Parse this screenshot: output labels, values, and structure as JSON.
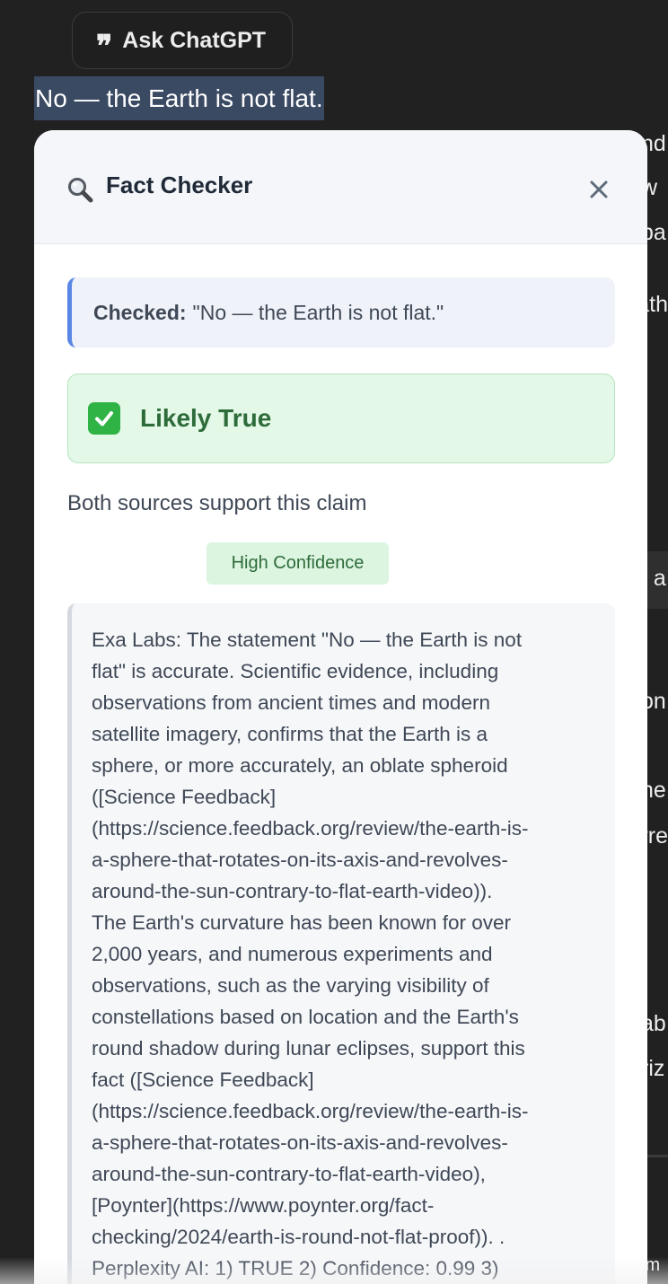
{
  "ask_button": {
    "icon": "quote-icon",
    "label": "Ask ChatGPT"
  },
  "selection": {
    "text": "No — the Earth is not flat."
  },
  "background_fragments": [
    "nd",
    "w",
    "pa",
    "ath",
    "t a",
    "on",
    "he",
    "rre",
    "ab",
    "riz",
    "im"
  ],
  "panel": {
    "icon": "magnifier-icon",
    "title": "Fact Checker",
    "close_icon": "close-icon",
    "checked_label": "Checked:",
    "checked_text": "\"No — the Earth is not flat.\"",
    "verdict": {
      "icon": "check-icon",
      "label": "Likely True",
      "color": "#2e6b3a"
    },
    "summary": "Both sources support this claim",
    "confidence": "High Confidence",
    "details_lines": [
      "Exa Labs: The statement \"No — the Earth is not",
      "flat\" is accurate. Scientific evidence, including",
      "observations from ancient times and modern",
      "satellite imagery, confirms that the Earth is a",
      "sphere, or more accurately, an oblate spheroid",
      "([Science Feedback]",
      "(https://science.feedback.org/review/the-earth-is-",
      "a-sphere-that-rotates-on-its-axis-and-revolves-",
      "around-the-sun-contrary-to-flat-earth-video)).",
      "The Earth's curvature has been known for over",
      "2,000 years, and numerous experiments and",
      "observations, such as the varying visibility of",
      "constellations based on location and the Earth's",
      "round shadow during lunar eclipses, support this",
      "fact ([Science Feedback]",
      "(https://science.feedback.org/review/the-earth-is-",
      "a-sphere-that-rotates-on-its-axis-and-revolves-",
      "around-the-sun-contrary-to-flat-earth-video),",
      "[Poynter](https://www.poynter.org/fact-",
      "checking/2024/earth-is-round-not-flat-proof)). .",
      "Perplexity AI: 1) TRUE 2) Confidence: 0.99 3)"
    ]
  }
}
